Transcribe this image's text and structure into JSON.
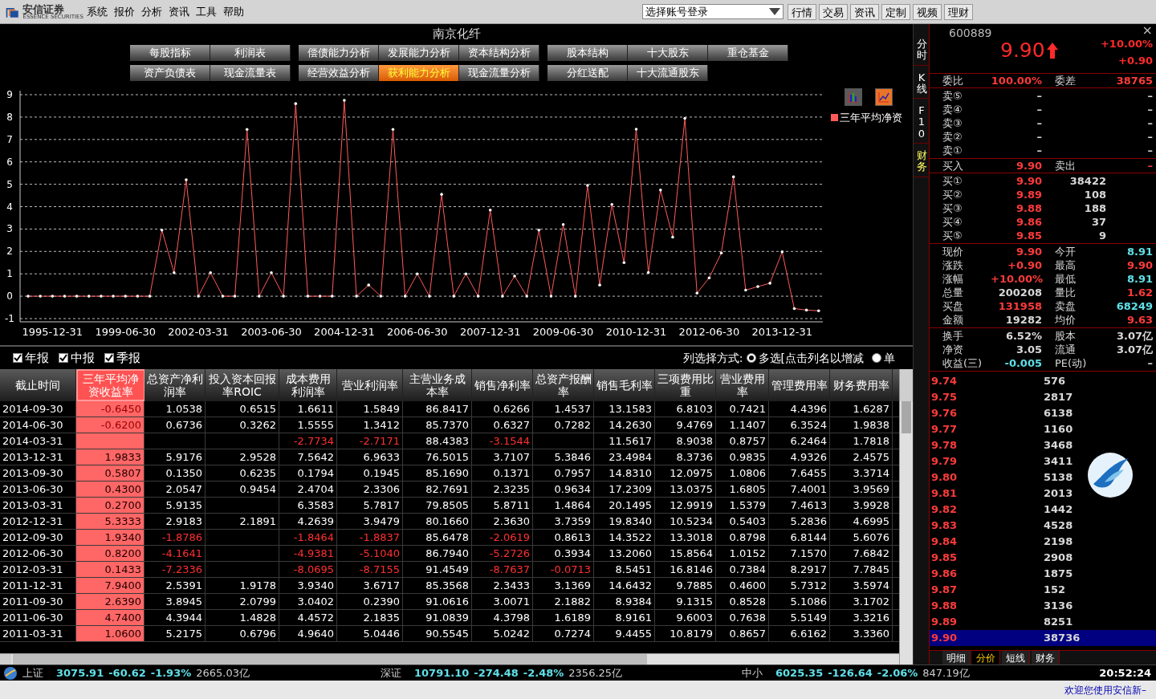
{
  "app": {
    "logo_text": "安信证券",
    "logo_subtext": "ESSENCE SECURITIES",
    "menu": [
      "系统",
      "报价",
      "分析",
      "资讯",
      "工具",
      "帮助"
    ],
    "account_select": {
      "value": "选择账号登录"
    },
    "toolbar_buttons": [
      "行情",
      "交易",
      "资讯",
      "定制",
      "视频",
      "理财"
    ]
  },
  "stock_title": "南京化纤",
  "report_buttons": [
    {
      "groups": [
        [
          {
            "label": "每股指标",
            "selected": false
          },
          {
            "label": "利润表",
            "selected": false
          }
        ],
        [
          {
            "label": "偿债能力分析",
            "selected": false
          },
          {
            "label": "发展能力分析",
            "selected": false
          },
          {
            "label": "资本结构分析",
            "selected": false
          }
        ],
        [
          {
            "label": "股本结构",
            "selected": false
          },
          {
            "label": "十大股东",
            "selected": false
          },
          {
            "label": "重仓基金",
            "selected": false
          }
        ]
      ]
    },
    {
      "groups": [
        [
          {
            "label": "资产负债表",
            "selected": false
          },
          {
            "label": "现金流量表",
            "selected": false
          }
        ],
        [
          {
            "label": "经营效益分析",
            "selected": false
          },
          {
            "label": "获利能力分析",
            "selected": true
          },
          {
            "label": "现金流量分析",
            "selected": false
          }
        ],
        [
          {
            "label": "分红送配",
            "selected": false
          },
          {
            "label": "十大流通股东",
            "selected": false
          }
        ]
      ]
    }
  ],
  "chart_type_buttons": [
    {
      "kind": "bar",
      "selected": false
    },
    {
      "kind": "line",
      "selected": true
    }
  ],
  "chart": {
    "chart_data": {
      "type": "line",
      "categories": [
        null,
        null,
        "1995-12-31",
        null,
        null,
        null,
        null,
        null,
        "1999-06-30",
        null,
        null,
        null,
        null,
        null,
        "2002-03-31",
        null,
        null,
        null,
        null,
        null,
        "2003-06-30",
        null,
        null,
        null,
        null,
        null,
        "2004-12-31",
        null,
        null,
        null,
        null,
        null,
        "2006-06-30",
        null,
        null,
        null,
        null,
        null,
        "2007-12-31",
        null,
        null,
        null,
        null,
        null,
        "2009-06-30",
        null,
        null,
        null,
        null,
        null,
        "2010-12-31",
        null,
        null,
        null,
        null,
        null,
        "2012-06-30",
        null,
        null,
        null,
        null,
        null,
        "2013-12-31",
        null,
        null,
        null
      ],
      "series": [
        {
          "name": "三年平均净资",
          "color": "#ff5a5a",
          "values": [
            0,
            0,
            0,
            0,
            0,
            0,
            0,
            0,
            0,
            0,
            0,
            2.95,
            1.05,
            5.2,
            0,
            1.05,
            0,
            0,
            7.45,
            0,
            1.05,
            0,
            8.6,
            0,
            0,
            0,
            8.75,
            0,
            0.5,
            0,
            7.45,
            0,
            1.0,
            0,
            4.55,
            0,
            1.0,
            0,
            3.85,
            0,
            0.9,
            0,
            2.95,
            0,
            3.2,
            0,
            4.95,
            0.5,
            4.1,
            1.5,
            7.46,
            1.06,
            4.74,
            2.64,
            7.94,
            0.14,
            0.82,
            1.93,
            5.33,
            0.27,
            0.43,
            0.58,
            1.98,
            -0.55,
            -0.62,
            -0.65
          ]
        }
      ],
      "ylim": [
        -1,
        9
      ],
      "yticks": [
        -1,
        0,
        1,
        2,
        3,
        4,
        5,
        6,
        7,
        8,
        9
      ],
      "grid": true
    }
  },
  "filters": [
    {
      "label": "年报",
      "checked": true
    },
    {
      "label": "中报",
      "checked": true
    },
    {
      "label": "季报",
      "checked": true
    }
  ],
  "column_mode": {
    "label": "列选择方式:",
    "options": [
      {
        "label": "多选[点击列名以增减",
        "selected": true
      },
      {
        "label": "单",
        "selected": false
      }
    ]
  },
  "table": {
    "columns": [
      {
        "label": "截止时间",
        "selected": false
      },
      {
        "label": "三年平均净资收益率",
        "selected": true
      },
      {
        "label": "总资产净利润率",
        "selected": false
      },
      {
        "label": "投入资本回报率ROIC",
        "selected": false
      },
      {
        "label": "成本费用利润率",
        "selected": false
      },
      {
        "label": "营业利润率",
        "selected": false
      },
      {
        "label": "主营业务成本率",
        "selected": false
      },
      {
        "label": "销售净利率",
        "selected": false
      },
      {
        "label": "总资产报酬率",
        "selected": false
      },
      {
        "label": "销售毛利率",
        "selected": false
      },
      {
        "label": "三项费用比重",
        "selected": false
      },
      {
        "label": "营业费用率",
        "selected": false
      },
      {
        "label": "管理费用率",
        "selected": false
      },
      {
        "label": "财务费用率",
        "selected": false
      }
    ],
    "rows": [
      [
        "2014-09-30",
        "-0.6450",
        "1.0538",
        "0.6515",
        "1.6611",
        "1.5849",
        "86.8417",
        "0.6266",
        "1.4537",
        "13.1583",
        "6.8103",
        "0.7421",
        "4.4396",
        "1.6287"
      ],
      [
        "2014-06-30",
        "-0.6200",
        "0.6736",
        "0.3262",
        "1.5555",
        "1.3412",
        "85.7370",
        "0.6327",
        "0.7282",
        "14.2630",
        "9.4769",
        "1.1407",
        "6.3524",
        "1.9838"
      ],
      [
        "2014-03-31",
        null,
        null,
        null,
        "-2.7734",
        "-2.7171",
        "88.4383",
        "-3.1544",
        null,
        "11.5617",
        "8.9038",
        "0.8757",
        "6.2464",
        "1.7818"
      ],
      [
        "2013-12-31",
        "1.9833",
        "5.9176",
        "2.9528",
        "7.5642",
        "6.9633",
        "76.5015",
        "3.7107",
        "5.3846",
        "23.4984",
        "8.3736",
        "0.9835",
        "4.9326",
        "2.4575"
      ],
      [
        "2013-09-30",
        "0.5807",
        "0.1350",
        "0.6235",
        "0.1794",
        "0.1945",
        "85.1690",
        "0.1371",
        "0.7957",
        "14.8310",
        "12.0975",
        "1.0806",
        "7.6455",
        "3.3714"
      ],
      [
        "2013-06-30",
        "0.4300",
        "2.0547",
        "0.9454",
        "2.4704",
        "2.3306",
        "82.7691",
        "2.3235",
        "0.9634",
        "17.2309",
        "13.0375",
        "1.6805",
        "7.4001",
        "3.9569"
      ],
      [
        "2013-03-31",
        "0.2700",
        "5.9135",
        null,
        "6.3583",
        "5.7817",
        "79.8505",
        "5.8711",
        "1.4864",
        "20.1495",
        "12.9919",
        "1.5379",
        "7.4613",
        "3.9928"
      ],
      [
        "2012-12-31",
        "5.3333",
        "2.9183",
        "2.1891",
        "4.2639",
        "3.9479",
        "80.1660",
        "2.3630",
        "3.7359",
        "19.8340",
        "10.5234",
        "0.5403",
        "5.2836",
        "4.6995"
      ],
      [
        "2012-09-30",
        "1.9340",
        "-1.8786",
        null,
        "-1.8464",
        "-1.8837",
        "85.6478",
        "-2.0619",
        "0.8613",
        "14.3522",
        "13.3018",
        "0.8798",
        "6.8144",
        "5.6076"
      ],
      [
        "2012-06-30",
        "0.8200",
        "-4.1641",
        null,
        "-4.9381",
        "-5.1040",
        "86.7940",
        "-5.2726",
        "0.3934",
        "13.2060",
        "15.8564",
        "1.0152",
        "7.1570",
        "7.6842"
      ],
      [
        "2012-03-31",
        "0.1433",
        "-7.2336",
        null,
        "-8.0695",
        "-8.7155",
        "91.4549",
        "-8.7637",
        "-0.0713",
        "8.5451",
        "16.8146",
        "0.7384",
        "8.2917",
        "7.7845"
      ],
      [
        "2011-12-31",
        "7.9400",
        "2.5391",
        "1.9178",
        "3.9340",
        "3.6717",
        "85.3568",
        "2.3433",
        "3.1369",
        "14.6432",
        "9.7885",
        "0.4600",
        "5.7312",
        "3.5974"
      ],
      [
        "2011-09-30",
        "2.6390",
        "3.8945",
        "2.0799",
        "3.0402",
        "0.2390",
        "91.0616",
        "3.0071",
        "2.1882",
        "8.9384",
        "9.1315",
        "0.8528",
        "5.1086",
        "3.1702"
      ],
      [
        "2011-06-30",
        "4.7400",
        "4.3944",
        "1.4828",
        "4.4572",
        "2.1835",
        "91.0839",
        "4.3798",
        "1.6189",
        "8.9161",
        "9.6003",
        "0.7638",
        "5.5149",
        "3.3216"
      ],
      [
        "2011-03-31",
        "1.0600",
        "5.2175",
        "0.6796",
        "4.9640",
        "5.0446",
        "90.5545",
        "5.0242",
        "0.7274",
        "9.4455",
        "10.8179",
        "0.8657",
        "6.6162",
        "3.3360"
      ]
    ]
  },
  "side_tabs": [
    {
      "label": "分时",
      "selected": false
    },
    {
      "label": "K线",
      "selected": false
    },
    {
      "label": "F10",
      "selected": false
    },
    {
      "label": "财务",
      "selected": true
    }
  ],
  "quote": {
    "code": "600889",
    "close": "×",
    "price": "9.90",
    "change_pct": "+10.00%",
    "change": "+0.90",
    "ratio": [
      {
        "label": "委比",
        "value": "100.00%",
        "color": "#ff3b3b"
      },
      {
        "label": "委差",
        "value": "38765",
        "color": "#ff3b3b"
      }
    ],
    "sells": [
      {
        "label": "卖⑤",
        "price": "–",
        "volume": "–"
      },
      {
        "label": "卖④",
        "price": "–",
        "volume": "–"
      },
      {
        "label": "卖③",
        "price": "–",
        "volume": "–"
      },
      {
        "label": "卖②",
        "price": "–",
        "volume": "–"
      },
      {
        "label": "卖①",
        "price": "–",
        "volume": "–"
      }
    ],
    "bid_ask": {
      "label": "买入",
      "value": "9.90",
      "label2": "卖出",
      "value2": "–"
    },
    "buys": [
      {
        "label": "买①",
        "price": "9.90",
        "volume": "38422"
      },
      {
        "label": "买②",
        "price": "9.89",
        "volume": "108"
      },
      {
        "label": "买③",
        "price": "9.88",
        "volume": "188"
      },
      {
        "label": "买④",
        "price": "9.86",
        "volume": "37"
      },
      {
        "label": "买⑤",
        "price": "9.85",
        "volume": "9"
      }
    ],
    "stats": [
      [
        {
          "label": "现价",
          "value": "9.90",
          "color": "#ff3b3b"
        },
        {
          "label": "今开",
          "value": "8.91",
          "color": "#5fe0e8"
        }
      ],
      [
        {
          "label": "涨跌",
          "value": "+0.90",
          "color": "#ff3b3b"
        },
        {
          "label": "最高",
          "value": "9.90",
          "color": "#ff3b3b"
        }
      ],
      [
        {
          "label": "涨幅",
          "value": "+10.00%",
          "color": "#ff3b3b"
        },
        {
          "label": "最低",
          "value": "8.91",
          "color": "#5fe0e8"
        }
      ],
      [
        {
          "label": "总量",
          "value": "200208",
          "color": "#d8d8d8"
        },
        {
          "label": "量比",
          "value": "1.62",
          "color": "#ff3b3b"
        }
      ],
      [
        {
          "label": "买盘",
          "value": "131958",
          "color": "#ff3b3b"
        },
        {
          "label": "卖盘",
          "value": "68249",
          "color": "#5fe0e8"
        }
      ],
      [
        {
          "label": "金额",
          "value": "19282",
          "color": "#d8d8d8"
        },
        {
          "label": "均价",
          "value": "9.63",
          "color": "#ff3b3b"
        }
      ]
    ],
    "stats2": [
      [
        {
          "label": "换手",
          "value": "6.52%",
          "color": "#d8d8d8"
        },
        {
          "label": "股本",
          "value": "3.07亿",
          "color": "#d8d8d8"
        }
      ],
      [
        {
          "label": "净资",
          "value": "3.05",
          "color": "#d8d8d8"
        },
        {
          "label": "流通",
          "value": "3.07亿",
          "color": "#d8d8d8"
        }
      ],
      [
        {
          "label": "收益(三)",
          "value": "-0.005",
          "color": "#5fe0e8"
        },
        {
          "label": "PE(动)",
          "value": "–",
          "color": "#d8d8d8"
        }
      ]
    ]
  },
  "price_volume": [
    {
      "price": "9.74",
      "volume": "576",
      "selected": false
    },
    {
      "price": "9.75",
      "volume": "2817",
      "selected": false
    },
    {
      "price": "9.76",
      "volume": "6138",
      "selected": false
    },
    {
      "price": "9.77",
      "volume": "1160",
      "selected": false
    },
    {
      "price": "9.78",
      "volume": "3468",
      "selected": false
    },
    {
      "price": "9.79",
      "volume": "3411",
      "selected": false
    },
    {
      "price": "9.80",
      "volume": "5138",
      "selected": false
    },
    {
      "price": "9.81",
      "volume": "2013",
      "selected": false
    },
    {
      "price": "9.82",
      "volume": "1442",
      "selected": false
    },
    {
      "price": "9.83",
      "volume": "4528",
      "selected": false
    },
    {
      "price": "9.84",
      "volume": "2198",
      "selected": false
    },
    {
      "price": "9.85",
      "volume": "2908",
      "selected": false
    },
    {
      "price": "9.86",
      "volume": "1875",
      "selected": false
    },
    {
      "price": "9.87",
      "volume": "152",
      "selected": false
    },
    {
      "price": "9.88",
      "volume": "3136",
      "selected": false
    },
    {
      "price": "9.89",
      "volume": "8251",
      "selected": false
    },
    {
      "price": "9.90",
      "volume": "38736",
      "selected": true
    }
  ],
  "bottom_tabs": [
    {
      "label": "明细",
      "selected": false
    },
    {
      "label": "分价",
      "selected": true
    },
    {
      "label": "短线",
      "selected": false
    },
    {
      "label": "财务",
      "selected": false
    }
  ],
  "status_bar": {
    "indices": [
      {
        "name": "上证",
        "value": "3075.91",
        "change": "-60.62",
        "pct": "-1.93%",
        "amount": "2665.03亿"
      },
      {
        "name": "深证",
        "value": "10791.10",
        "change": "-274.48",
        "pct": "-2.48%",
        "amount": "2356.25亿"
      },
      {
        "name": "中小",
        "value": "6025.35",
        "change": "-126.64",
        "pct": "-2.06%",
        "amount": "847.19亿"
      }
    ],
    "time": "20:52:24",
    "welcome": "欢迎您使用安信新–"
  }
}
